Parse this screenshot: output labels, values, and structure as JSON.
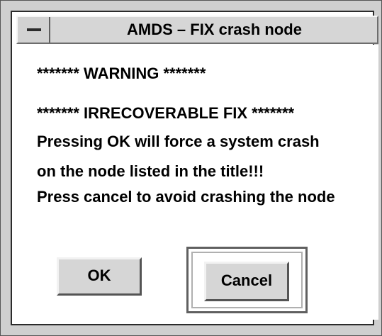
{
  "window": {
    "title": "AMDS – FIX crash node",
    "menu_icon": "window-menu-dash-icon"
  },
  "message": {
    "line1": "******* WARNING *******",
    "line2": "******* IRRECOVERABLE FIX *******",
    "line3": "Pressing OK will force a system crash",
    "line4": "on the node listed in the title!!!",
    "line5": "Press cancel to avoid crashing the node"
  },
  "buttons": {
    "ok_label": "OK",
    "cancel_label": "Cancel",
    "default": "cancel"
  },
  "colors": {
    "window_bg": "#cfcfcf",
    "content_bg": "#ffffff",
    "button_bg": "#d6d6d6",
    "text": "#000000"
  }
}
